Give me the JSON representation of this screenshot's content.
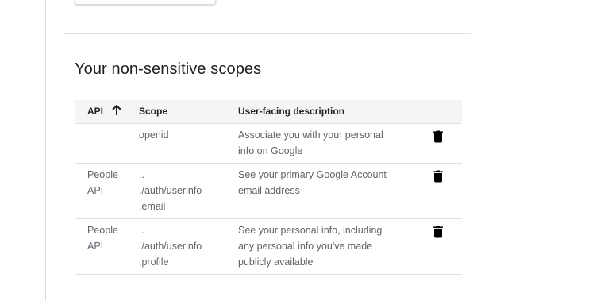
{
  "section": {
    "title": "Your non-sensitive scopes"
  },
  "table": {
    "headers": {
      "api": "API",
      "scope": "Scope",
      "description": "User-facing description"
    },
    "sort": {
      "column": "API",
      "direction": "ascending",
      "icon": "arrow-up-icon"
    },
    "rows": [
      {
        "api_lines": [
          "",
          ""
        ],
        "scope_lines": [
          "openid"
        ],
        "description_lines": [
          "Associate you with your personal",
          "info on Google"
        ],
        "action_icon": "trash-icon"
      },
      {
        "api_lines": [
          "People",
          "API"
        ],
        "scope_lines": [
          "..",
          "./auth/userinfo",
          ".email"
        ],
        "description_lines": [
          "See your primary Google Account",
          "email address"
        ],
        "action_icon": "trash-icon"
      },
      {
        "api_lines": [
          "People",
          "API"
        ],
        "scope_lines": [
          "..",
          "./auth/userinfo",
          ".profile"
        ],
        "description_lines": [
          "See your personal info, including",
          "any personal info you've made",
          "publicly available"
        ],
        "action_icon": "trash-icon"
      }
    ]
  },
  "colors": {
    "header_bg": "#f5f5f5",
    "text_primary": "#202124",
    "text_secondary": "#5f6368",
    "divider": "#e0e0e0"
  }
}
